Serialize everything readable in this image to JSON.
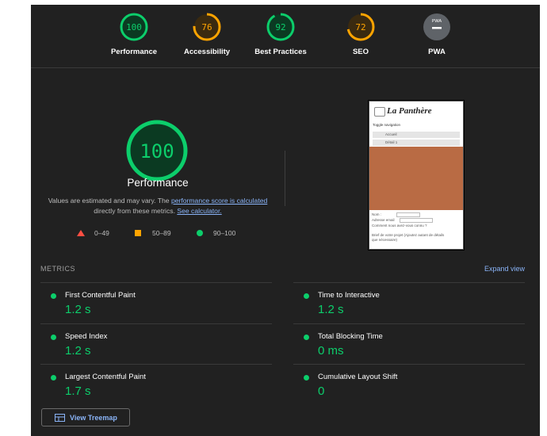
{
  "colors": {
    "pass": "#0cce6b",
    "average": "#ffa400",
    "fail": "#ff4e42",
    "link": "#8ab4f8",
    "background": "#212121"
  },
  "categories": [
    {
      "score": "100",
      "label": "Performance",
      "fraction": 1.0,
      "color": "#0cce6b"
    },
    {
      "score": "76",
      "label": "Accessibility",
      "fraction": 0.76,
      "color": "#ffa400"
    },
    {
      "score": "92",
      "label": "Best Practices",
      "fraction": 0.92,
      "color": "#0cce6b"
    },
    {
      "score": "72",
      "label": "SEO",
      "fraction": 0.72,
      "color": "#ffa400"
    },
    {
      "score": "PWA",
      "label": "PWA",
      "fraction": 0,
      "color": "#5f6368"
    }
  ],
  "performance": {
    "score": "100",
    "title": "Performance",
    "desc_prefix": "Values are estimated and may vary. The ",
    "desc_link1": "performance score is calculated",
    "desc_mid": " directly from these metrics. ",
    "desc_link2": "See calculator."
  },
  "legend": {
    "fail": "0–49",
    "average": "50–89",
    "pass": "90–100"
  },
  "screenshot": {
    "site_title": "La Panthère",
    "toggle": "Toggle navigation",
    "nav1": "Accueil",
    "nav2": "Détail 1",
    "form_name": "Nom :",
    "form_email": "Adresse email",
    "form_question": "Comment nous avez-vous connu ?",
    "form_brief": "Brief de votre projet (Ajoutez autant de détails",
    "form_brief2": "que nécessaire)"
  },
  "metrics": {
    "header": "METRICS",
    "expand": "Expand view",
    "items": [
      {
        "title": "First Contentful Paint",
        "value": "1.2 s"
      },
      {
        "title": "Time to Interactive",
        "value": "1.2 s"
      },
      {
        "title": "Speed Index",
        "value": "1.2 s"
      },
      {
        "title": "Total Blocking Time",
        "value": "0 ms"
      },
      {
        "title": "Largest Contentful Paint",
        "value": "1.7 s"
      },
      {
        "title": "Cumulative Layout Shift",
        "value": "0"
      }
    ]
  },
  "treemap": {
    "label": "View Treemap"
  }
}
